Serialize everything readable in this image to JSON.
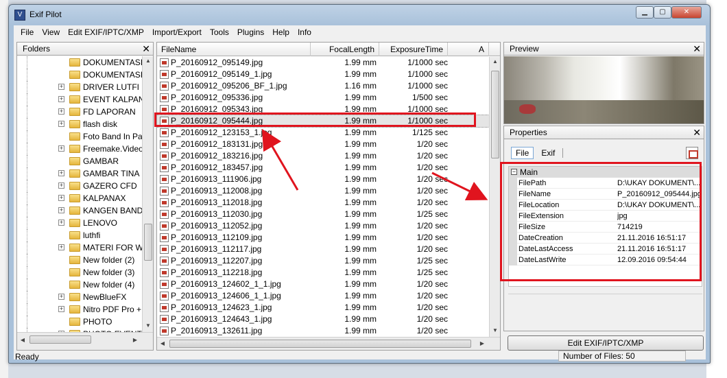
{
  "window": {
    "title": "Exif Pilot"
  },
  "menu": [
    "File",
    "View",
    "Edit EXIF/IPTC/XMP",
    "Import/Export",
    "Tools",
    "Plugins",
    "Help",
    "Info"
  ],
  "folders": {
    "header": "Folders",
    "items": [
      {
        "label": "DOKUMENTASI",
        "expandable": false
      },
      {
        "label": "DOKUMENTASI",
        "expandable": false
      },
      {
        "label": "DRIVER LUTFI",
        "expandable": true
      },
      {
        "label": "EVENT KALPAN",
        "expandable": true
      },
      {
        "label": "FD LAPORAN",
        "expandable": true
      },
      {
        "label": "flash disk",
        "expandable": true
      },
      {
        "label": "Foto Band In Pa",
        "expandable": false
      },
      {
        "label": "Freemake.Video",
        "expandable": true
      },
      {
        "label": "GAMBAR",
        "expandable": false
      },
      {
        "label": "GAMBAR TINA",
        "expandable": true
      },
      {
        "label": "GAZERO CFD",
        "expandable": true
      },
      {
        "label": "KALPANAX",
        "expandable": true
      },
      {
        "label": "KANGEN BAND",
        "expandable": true
      },
      {
        "label": "LENOVO",
        "expandable": true
      },
      {
        "label": "luthfi",
        "expandable": false
      },
      {
        "label": "MATERI FOR W",
        "expandable": true
      },
      {
        "label": "New folder (2)",
        "expandable": false
      },
      {
        "label": "New folder (3)",
        "expandable": false
      },
      {
        "label": "New folder (4)",
        "expandable": false
      },
      {
        "label": "NewBlueFX",
        "expandable": true
      },
      {
        "label": "Nitro PDF Pro +",
        "expandable": true
      },
      {
        "label": "PHOTO",
        "expandable": false
      },
      {
        "label": "PHOTO EVENT",
        "expandable": true
      }
    ]
  },
  "files": {
    "columns": [
      "FileName",
      "FocalLength",
      "ExposureTime",
      "A"
    ],
    "rows": [
      {
        "name": "P_20160912_095149.jpg",
        "focal": "1.99 mm",
        "exposure": "1/1000 sec"
      },
      {
        "name": "P_20160912_095149_1.jpg",
        "focal": "1.99 mm",
        "exposure": "1/1000 sec"
      },
      {
        "name": "P_20160912_095206_BF_1.jpg",
        "focal": "1.16 mm",
        "exposure": "1/1000 sec"
      },
      {
        "name": "P_20160912_095336.jpg",
        "focal": "1.99 mm",
        "exposure": "1/500 sec"
      },
      {
        "name": "P_20160912_095343.jpg",
        "focal": "1.99 mm",
        "exposure": "1/1000 sec"
      },
      {
        "name": "P_20160912_095444.jpg",
        "focal": "1.99 mm",
        "exposure": "1/1000 sec",
        "selected": true
      },
      {
        "name": "P_20160912_123153_1.jpg",
        "focal": "1.99 mm",
        "exposure": "1/125 sec"
      },
      {
        "name": "P_20160912_183131.jpg",
        "focal": "1.99 mm",
        "exposure": "1/20 sec"
      },
      {
        "name": "P_20160912_183216.jpg",
        "focal": "1.99 mm",
        "exposure": "1/20 sec"
      },
      {
        "name": "P_20160912_183457.jpg",
        "focal": "1.99 mm",
        "exposure": "1/20 sec"
      },
      {
        "name": "P_20160913_111906.jpg",
        "focal": "1.99 mm",
        "exposure": "1/20 sec"
      },
      {
        "name": "P_20160913_112008.jpg",
        "focal": "1.99 mm",
        "exposure": "1/20 sec"
      },
      {
        "name": "P_20160913_112018.jpg",
        "focal": "1.99 mm",
        "exposure": "1/20 sec"
      },
      {
        "name": "P_20160913_112030.jpg",
        "focal": "1.99 mm",
        "exposure": "1/25 sec"
      },
      {
        "name": "P_20160913_112052.jpg",
        "focal": "1.99 mm",
        "exposure": "1/20 sec"
      },
      {
        "name": "P_20160913_112109.jpg",
        "focal": "1.99 mm",
        "exposure": "1/20 sec"
      },
      {
        "name": "P_20160913_112117.jpg",
        "focal": "1.99 mm",
        "exposure": "1/20 sec"
      },
      {
        "name": "P_20160913_112207.jpg",
        "focal": "1.99 mm",
        "exposure": "1/25 sec"
      },
      {
        "name": "P_20160913_112218.jpg",
        "focal": "1.99 mm",
        "exposure": "1/25 sec"
      },
      {
        "name": "P_20160913_124602_1_1.jpg",
        "focal": "1.99 mm",
        "exposure": "1/20 sec"
      },
      {
        "name": "P_20160913_124606_1_1.jpg",
        "focal": "1.99 mm",
        "exposure": "1/20 sec"
      },
      {
        "name": "P_20160913_124623_1.jpg",
        "focal": "1.99 mm",
        "exposure": "1/20 sec"
      },
      {
        "name": "P_20160913_124643_1.jpg",
        "focal": "1.99 mm",
        "exposure": "1/20 sec"
      },
      {
        "name": "P_20160913_132611.jpg",
        "focal": "1.99 mm",
        "exposure": "1/20 sec"
      }
    ]
  },
  "preview": {
    "header": "Preview"
  },
  "properties": {
    "header": "Properties",
    "tabs": [
      "File",
      "Exif"
    ],
    "active_tab": "File",
    "group": "Main",
    "rows": [
      {
        "key": "FilePath",
        "value": "D:\\UKAY DOKUMENT\\..."
      },
      {
        "key": "FileName",
        "value": "P_20160912_095444.jpg"
      },
      {
        "key": "FileLocation",
        "value": "D:\\UKAY DOKUMENT\\..."
      },
      {
        "key": "FileExtension",
        "value": "jpg"
      },
      {
        "key": "FileSize",
        "value": "714219"
      },
      {
        "key": "DateCreation",
        "value": "21.11.2016 16:51:17"
      },
      {
        "key": "DateLastAccess",
        "value": "21.11.2016 16:51:17"
      },
      {
        "key": "DateLastWrite",
        "value": "12.09.2016 09:54:44"
      }
    ]
  },
  "edit_button": "Edit EXIF/IPTC/XMP",
  "status": {
    "left": "Ready",
    "right": "Number of Files: 50"
  },
  "colors": {
    "highlight": "#e0141e",
    "selection": "#e5e5e5",
    "title_bar": "#bfd2e6"
  }
}
